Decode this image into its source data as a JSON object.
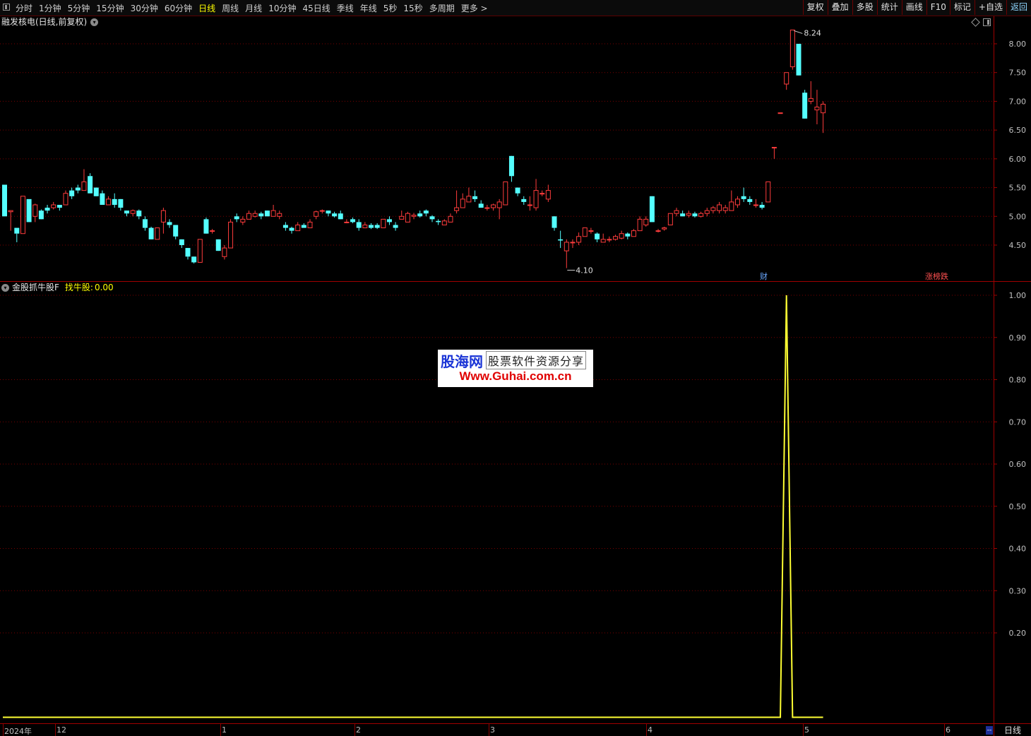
{
  "toolbar": {
    "periods": [
      {
        "label": "分时"
      },
      {
        "label": "1分钟"
      },
      {
        "label": "5分钟"
      },
      {
        "label": "15分钟"
      },
      {
        "label": "30分钟"
      },
      {
        "label": "60分钟"
      },
      {
        "label": "日线",
        "active": true
      },
      {
        "label": "周线"
      },
      {
        "label": "月线"
      },
      {
        "label": "10分钟"
      },
      {
        "label": "45日线"
      },
      {
        "label": "季线"
      },
      {
        "label": "年线"
      },
      {
        "label": "5秒"
      },
      {
        "label": "15秒"
      },
      {
        "label": "多周期"
      },
      {
        "label": "更多 >"
      }
    ],
    "buttons": [
      {
        "label": "复权"
      },
      {
        "label": "叠加"
      },
      {
        "label": "多股"
      },
      {
        "label": "统计"
      },
      {
        "label": "画线"
      },
      {
        "label": "F10"
      },
      {
        "label": "标记"
      },
      {
        "label": "+自选"
      },
      {
        "label": "返回",
        "back": true
      }
    ]
  },
  "main_chart": {
    "title": "融发核电(日线,前复权)",
    "max_label": "8.24",
    "min_label": "4.10",
    "markers": {
      "finance": "财",
      "limit": "涨榜跌"
    },
    "y_ticks": [
      "8.00",
      "7.50",
      "7.00",
      "6.50",
      "6.00",
      "5.50",
      "5.00",
      "4.50"
    ]
  },
  "indicator": {
    "name": "金股抓牛股F",
    "line_label": "找牛股:",
    "line_value": "0.00",
    "y_ticks": [
      "1.00",
      "0.90",
      "0.80",
      "0.70",
      "0.60",
      "0.50",
      "0.40",
      "0.30",
      "0.20"
    ]
  },
  "watermark": {
    "logo": "股海网",
    "tagline": "股票软件资源分享",
    "url": "Www.Guhai.com.cn"
  },
  "date_axis": {
    "labels": [
      {
        "text": "2024年"
      },
      {
        "text": "12"
      },
      {
        "text": "1"
      },
      {
        "text": "2"
      },
      {
        "text": "3"
      },
      {
        "text": "4"
      },
      {
        "text": "5"
      },
      {
        "text": "6"
      }
    ],
    "period": "日线",
    "scroll_indicator": "--"
  },
  "colors": {
    "up": "#ff3c3c",
    "down": "#54ffff",
    "indicator_line": "#ffff33",
    "grid": "#7a0000",
    "axis": "#a00000"
  },
  "chart_data": [
    {
      "type": "candlestick",
      "title": "融发核电(日线,前复权)",
      "x": "trading days, 2024-11-29 to 2025-06-10",
      "y_range": [
        4.0,
        8.3
      ],
      "y_ticks": [
        4.5,
        5.0,
        5.5,
        6.0,
        6.5,
        7.0,
        7.5,
        8.0
      ],
      "ohlc": [
        [
          5.55,
          5.0,
          5.55,
          5.0
        ],
        [
          5.08,
          5.1,
          4.75,
          5.1
        ],
        [
          4.8,
          4.7,
          4.55,
          4.7
        ],
        [
          4.7,
          5.35,
          4.7,
          5.3
        ],
        [
          5.3,
          4.9,
          4.9,
          5.05
        ],
        [
          5.0,
          5.2,
          4.9,
          5.22
        ],
        [
          5.1,
          4.95,
          4.95,
          5.12
        ],
        [
          5.15,
          5.1,
          5.05,
          5.2
        ],
        [
          5.15,
          5.2,
          5.12,
          5.25
        ],
        [
          5.2,
          5.15,
          5.1,
          5.2
        ],
        [
          5.2,
          5.4,
          5.2,
          5.45
        ],
        [
          5.45,
          5.35,
          5.3,
          5.5
        ],
        [
          5.5,
          5.45,
          5.4,
          5.55
        ],
        [
          5.45,
          5.6,
          5.45,
          5.82
        ],
        [
          5.7,
          5.4,
          5.4,
          5.75
        ],
        [
          5.5,
          5.35,
          5.35,
          5.5
        ],
        [
          5.4,
          5.2,
          5.2,
          5.45
        ],
        [
          5.2,
          5.3,
          5.2,
          5.35
        ],
        [
          5.3,
          5.2,
          5.15,
          5.4
        ],
        [
          5.3,
          5.15,
          5.1,
          5.3
        ],
        [
          5.1,
          5.05,
          5.0,
          5.1
        ],
        [
          5.05,
          5.1,
          5.0,
          5.12
        ],
        [
          5.1,
          5.0,
          4.95,
          5.12
        ],
        [
          4.95,
          4.8,
          4.75,
          5.0
        ],
        [
          4.8,
          4.6,
          4.6,
          4.82
        ],
        [
          4.6,
          4.8,
          4.6,
          4.8
        ],
        [
          4.9,
          5.1,
          4.7,
          5.15
        ],
        [
          4.9,
          4.85,
          4.8,
          4.95
        ],
        [
          4.85,
          4.65,
          4.6,
          4.85
        ],
        [
          4.6,
          4.5,
          4.45,
          4.6
        ],
        [
          4.45,
          4.3,
          4.25,
          4.45
        ],
        [
          4.3,
          4.2,
          4.18,
          4.3
        ],
        [
          4.2,
          4.6,
          4.2,
          4.6
        ],
        [
          4.95,
          4.7,
          4.7,
          4.98
        ],
        [
          4.75,
          4.75,
          4.7,
          4.78
        ],
        [
          4.6,
          4.4,
          4.4,
          4.6
        ],
        [
          4.3,
          4.45,
          4.25,
          4.5
        ],
        [
          4.45,
          4.9,
          4.45,
          4.95
        ],
        [
          5.0,
          4.95,
          4.9,
          5.05
        ],
        [
          4.9,
          4.95,
          4.85,
          5.0
        ],
        [
          4.95,
          5.05,
          4.95,
          5.1
        ],
        [
          5.0,
          5.05,
          4.98,
          5.1
        ],
        [
          5.05,
          5.0,
          4.95,
          5.08
        ],
        [
          5.1,
          5.0,
          5.0,
          5.1
        ],
        [
          5.0,
          5.1,
          5.0,
          5.2
        ],
        [
          5.0,
          5.05,
          4.95,
          5.1
        ],
        [
          4.85,
          4.8,
          4.75,
          4.9
        ],
        [
          4.8,
          4.75,
          4.7,
          4.82
        ],
        [
          4.75,
          4.85,
          4.75,
          4.9
        ],
        [
          4.85,
          4.8,
          4.8,
          4.88
        ],
        [
          4.8,
          4.9,
          4.8,
          4.95
        ],
        [
          5.0,
          5.08,
          4.95,
          5.1
        ],
        [
          5.1,
          5.1,
          5.05,
          5.12
        ],
        [
          5.1,
          5.05,
          5.0,
          5.1
        ],
        [
          5.05,
          5.0,
          4.98,
          5.08
        ],
        [
          5.05,
          4.95,
          4.95,
          5.1
        ],
        [
          4.9,
          4.9,
          4.88,
          4.95
        ],
        [
          4.95,
          4.9,
          4.88,
          4.98
        ],
        [
          4.9,
          4.8,
          4.75,
          4.95
        ],
        [
          4.8,
          4.85,
          4.8,
          4.9
        ],
        [
          4.85,
          4.8,
          4.78,
          4.88
        ],
        [
          4.85,
          4.8,
          4.78,
          4.88
        ],
        [
          4.8,
          4.95,
          4.8,
          4.95
        ],
        [
          4.95,
          4.9,
          4.85,
          5.0
        ],
        [
          4.85,
          4.8,
          4.75,
          4.9
        ],
        [
          4.95,
          5.0,
          4.95,
          5.1
        ],
        [
          4.9,
          5.05,
          4.9,
          5.08
        ],
        [
          5.0,
          5.02,
          4.95,
          5.06
        ],
        [
          5.05,
          5.0,
          4.98,
          5.1
        ],
        [
          5.1,
          5.05,
          5.0,
          5.12
        ],
        [
          5.0,
          4.95,
          4.9,
          5.02
        ],
        [
          4.92,
          4.9,
          4.85,
          4.95
        ],
        [
          4.85,
          4.92,
          4.85,
          4.95
        ],
        [
          4.9,
          5.0,
          4.9,
          5.05
        ],
        [
          5.1,
          5.15,
          5.05,
          5.45
        ],
        [
          5.15,
          5.3,
          5.15,
          5.4
        ],
        [
          5.25,
          5.35,
          5.25,
          5.5
        ],
        [
          5.35,
          5.3,
          5.25,
          5.45
        ],
        [
          5.22,
          5.15,
          5.15,
          5.28
        ],
        [
          5.15,
          5.15,
          5.1,
          5.2
        ],
        [
          5.15,
          5.2,
          5.1,
          5.22
        ],
        [
          5.15,
          5.25,
          4.95,
          5.3
        ],
        [
          5.2,
          5.6,
          5.2,
          5.6
        ],
        [
          6.05,
          5.7,
          5.6,
          6.05
        ],
        [
          5.5,
          5.4,
          5.35,
          5.5
        ],
        [
          5.3,
          5.25,
          5.2,
          5.35
        ],
        [
          5.2,
          5.2,
          5.1,
          5.35
        ],
        [
          5.15,
          5.45,
          5.1,
          5.65
        ],
        [
          5.4,
          5.4,
          5.35,
          5.45
        ],
        [
          5.3,
          5.45,
          5.25,
          5.55
        ],
        [
          5.0,
          4.8,
          4.75,
          5.0
        ],
        [
          4.6,
          4.58,
          4.45,
          4.75
        ],
        [
          4.4,
          4.55,
          4.1,
          4.6
        ],
        [
          4.55,
          4.55,
          4.45,
          4.6
        ],
        [
          4.55,
          4.65,
          4.5,
          4.72
        ],
        [
          4.65,
          4.8,
          4.65,
          4.8
        ],
        [
          4.75,
          4.75,
          4.7,
          4.8
        ],
        [
          4.7,
          4.6,
          4.55,
          4.72
        ],
        [
          4.55,
          4.6,
          4.55,
          4.7
        ],
        [
          4.6,
          4.6,
          4.55,
          4.65
        ],
        [
          4.6,
          4.65,
          4.58,
          4.68
        ],
        [
          4.62,
          4.7,
          4.6,
          4.75
        ],
        [
          4.7,
          4.65,
          4.6,
          4.72
        ],
        [
          4.65,
          4.75,
          4.65,
          4.78
        ],
        [
          4.75,
          4.95,
          4.75,
          5.0
        ],
        [
          4.85,
          4.95,
          4.82,
          5.0
        ],
        [
          5.35,
          4.9,
          4.9,
          5.35
        ],
        [
          4.75,
          4.75,
          4.72,
          4.78
        ],
        [
          4.78,
          4.8,
          4.75,
          4.82
        ],
        [
          4.85,
          5.05,
          4.85,
          5.05
        ],
        [
          5.05,
          5.1,
          5.0,
          5.15
        ],
        [
          5.05,
          5.0,
          5.0,
          5.1
        ],
        [
          5.02,
          5.05,
          4.98,
          5.1
        ],
        [
          5.05,
          5.0,
          4.98,
          5.08
        ],
        [
          5.0,
          5.05,
          4.98,
          5.08
        ],
        [
          5.05,
          5.1,
          5.0,
          5.15
        ],
        [
          5.1,
          5.15,
          5.05,
          5.18
        ],
        [
          5.1,
          5.2,
          5.05,
          5.25
        ],
        [
          5.1,
          5.15,
          5.05,
          5.2
        ],
        [
          5.1,
          5.25,
          5.1,
          5.45
        ],
        [
          5.2,
          5.3,
          5.15,
          5.35
        ],
        [
          5.35,
          5.3,
          5.25,
          5.5
        ],
        [
          5.3,
          5.25,
          5.2,
          5.35
        ],
        [
          5.2,
          5.2,
          5.15,
          5.3
        ],
        [
          5.2,
          5.15,
          5.12,
          5.25
        ],
        [
          5.25,
          5.6,
          5.25,
          5.6
        ],
        [
          6.2,
          6.2,
          6.0,
          6.2
        ],
        [
          6.8,
          6.8,
          6.8,
          6.8
        ],
        [
          7.3,
          7.5,
          7.2,
          7.5
        ],
        [
          7.6,
          8.24,
          7.55,
          8.24
        ],
        [
          8.0,
          7.45,
          7.45,
          8.0
        ],
        [
          7.15,
          6.7,
          6.7,
          7.2
        ],
        [
          7.0,
          7.05,
          6.95,
          7.35
        ],
        [
          6.85,
          6.9,
          6.6,
          7.2
        ],
        [
          6.8,
          6.95,
          6.45,
          7.0
        ]
      ]
    },
    {
      "type": "line",
      "title": "金股抓牛股F",
      "series": [
        {
          "name": "找牛股",
          "last_value": 0.0,
          "signal_at_index": 128,
          "signal_value": 1.0
        }
      ],
      "y_range": [
        0.0,
        1.0
      ],
      "y_ticks": [
        0.2,
        0.3,
        0.4,
        0.5,
        0.6,
        0.7,
        0.8,
        0.9,
        1.0
      ]
    }
  ]
}
